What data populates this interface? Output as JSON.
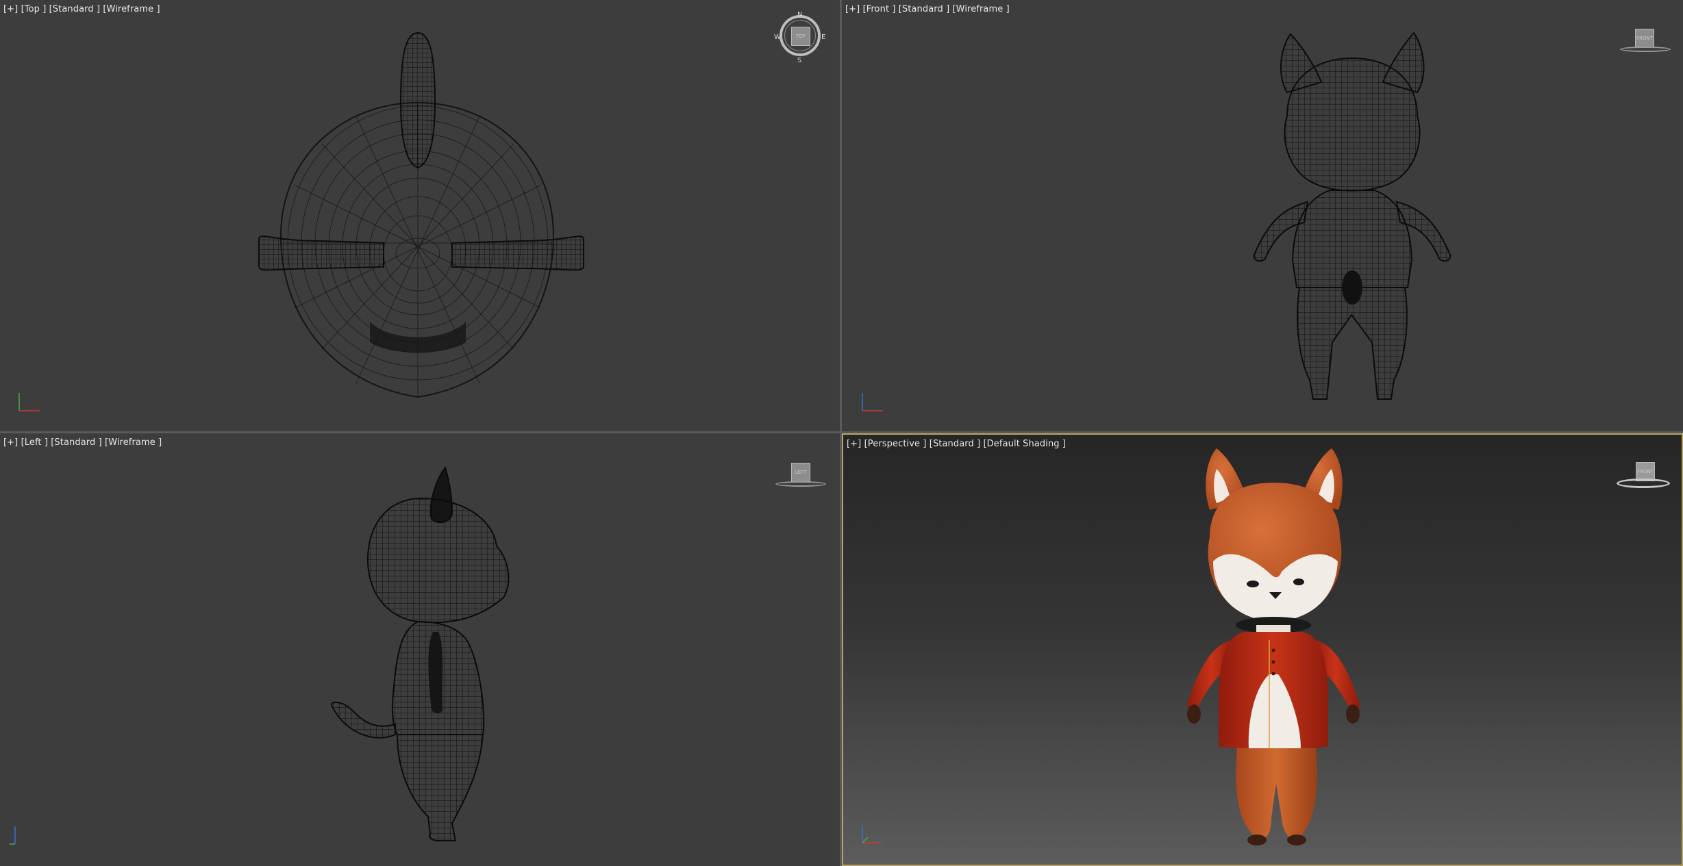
{
  "viewports": {
    "top": {
      "label": "[+] [Top ] [Standard ] [Wireframe ]",
      "cube": "TOP",
      "compass": {
        "n": "N",
        "s": "S",
        "e": "E",
        "w": "W"
      }
    },
    "front": {
      "label": "[+] [Front ] [Standard ] [Wireframe ]",
      "cube": "FRONT"
    },
    "left": {
      "label": "[+] [Left ] [Standard ] [Wireframe ]",
      "cube": "LEFT"
    },
    "persp": {
      "label": "[+] [Perspective ] [Standard ] [Default Shading ]",
      "cube": "FRONT"
    }
  },
  "colors": {
    "wire_bg": "#3d3d3d",
    "wire_line": "#111111",
    "active_border": "#b7a462",
    "fox_orange": "#c85a22",
    "jacket_red": "#b32a14",
    "fur_white": "#f1ece6"
  }
}
